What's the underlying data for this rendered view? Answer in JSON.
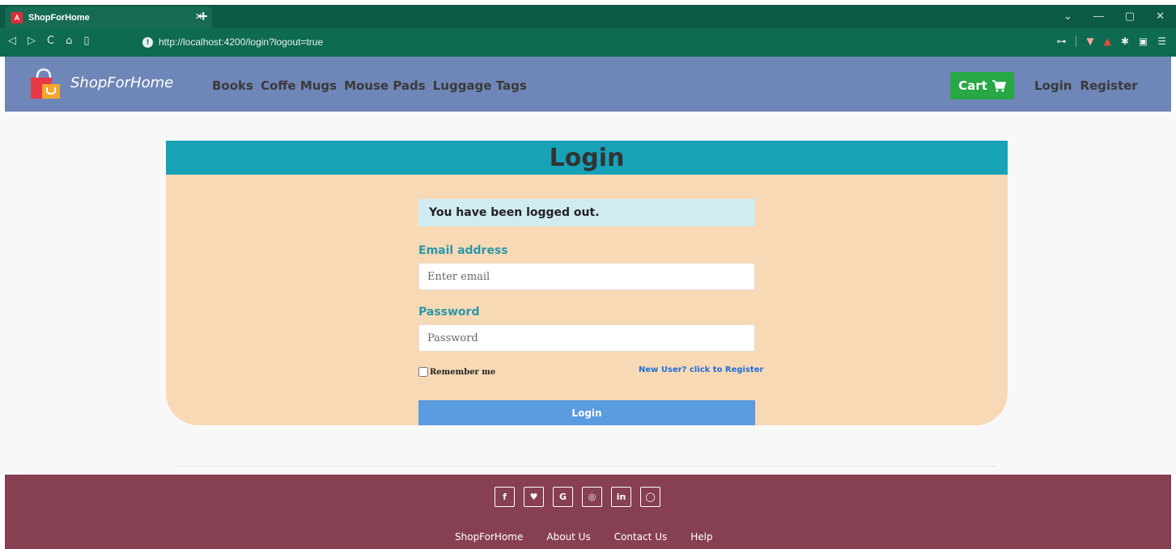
{
  "browser": {
    "tab_title": "ShopForHome",
    "tab_favicon": "A",
    "close_glyph": "×",
    "new_tab_glyph": "+",
    "url": "http://localhost:4200/login?logout=true",
    "info_glyph": "!",
    "nav_icons": [
      "back-icon",
      "forward-icon",
      "reload-icon",
      "home-icon",
      "bookmark-icon"
    ],
    "window_controls": [
      "chevron-down-icon",
      "minimize-icon",
      "maximize-icon",
      "close-icon"
    ],
    "extension_icons": [
      "key-icon",
      "brave-shield-icon",
      "brave-rewards-icon",
      "puzzle-icon",
      "sidebar-icon",
      "menu-icon"
    ]
  },
  "navbar": {
    "brand": "ShopForHome",
    "links": [
      "Books",
      "Coffe Mugs",
      "Mouse Pads",
      "Luggage Tags"
    ],
    "cart_label": "Cart",
    "login_label": "Login",
    "register_label": "Register"
  },
  "login_card": {
    "title": "Login",
    "alert": "You have been logged out.",
    "email_label": "Email address",
    "email_placeholder": "Enter email",
    "email_value": "",
    "password_label": "Password",
    "password_placeholder": "Password",
    "password_value": "",
    "remember_label": "Remember me",
    "remember_checked": false,
    "register_link": "New User? click to Register",
    "submit_label": "Login"
  },
  "footer": {
    "social": [
      {
        "name": "facebook-icon",
        "glyph": "f"
      },
      {
        "name": "twitter-icon",
        "glyph": "♥"
      },
      {
        "name": "google-icon",
        "glyph": "G"
      },
      {
        "name": "instagram-icon",
        "glyph": "◎"
      },
      {
        "name": "linkedin-icon",
        "glyph": "in"
      },
      {
        "name": "github-icon",
        "glyph": "◯"
      }
    ],
    "links": [
      "ShopForHome",
      "About Us",
      "Contact Us",
      "Help"
    ]
  },
  "colors": {
    "browser_chrome": "#0e5f4a",
    "navbar": "#6f86b8",
    "card_header": "#17a2b8",
    "card_body": "#f8d9b5",
    "alert": "#d1ecf1",
    "cart_button": "#28a745",
    "login_button": "#5b9be0",
    "footer": "#873f52"
  }
}
